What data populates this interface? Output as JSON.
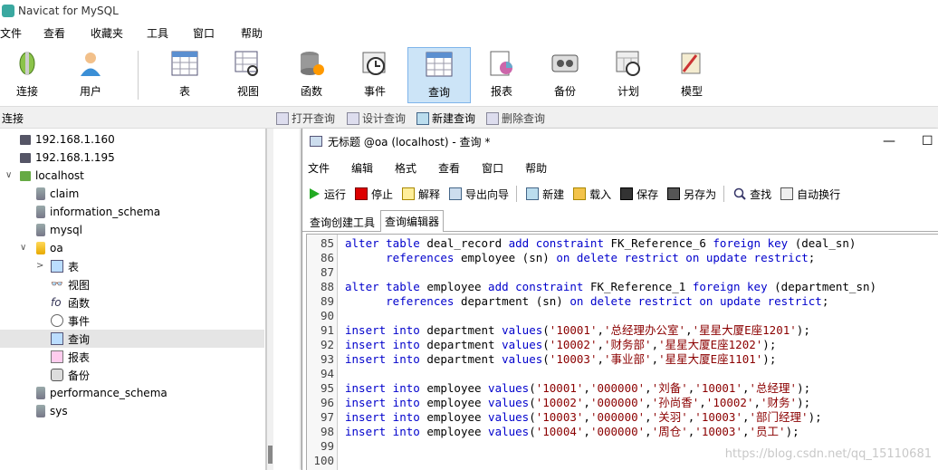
{
  "app": {
    "title": "Navicat for MySQL"
  },
  "menu": [
    "文件",
    "查看",
    "收藏夹",
    "工具",
    "窗口",
    "帮助"
  ],
  "toolbar": [
    {
      "label": "连接",
      "icon": "connection-icon"
    },
    {
      "label": "用户",
      "icon": "user-icon"
    },
    {
      "label": "表",
      "icon": "table-icon"
    },
    {
      "label": "视图",
      "icon": "view-icon"
    },
    {
      "label": "函数",
      "icon": "function-icon"
    },
    {
      "label": "事件",
      "icon": "event-clock-icon"
    },
    {
      "label": "查询",
      "icon": "query-icon",
      "active": true
    },
    {
      "label": "报表",
      "icon": "report-icon"
    },
    {
      "label": "备份",
      "icon": "backup-icon"
    },
    {
      "label": "计划",
      "icon": "schedule-icon"
    },
    {
      "label": "模型",
      "icon": "model-icon"
    }
  ],
  "subbar": {
    "connection_label": "连接",
    "buttons": [
      "打开查询",
      "设计查询",
      "新建查询",
      "删除查询"
    ]
  },
  "tree": [
    {
      "label": "192.168.1.160",
      "type": "server"
    },
    {
      "label": "192.168.1.195",
      "type": "server"
    },
    {
      "label": "localhost",
      "type": "server-open"
    },
    {
      "label": "claim",
      "type": "db"
    },
    {
      "label": "information_schema",
      "type": "db"
    },
    {
      "label": "mysql",
      "type": "db"
    },
    {
      "label": "oa",
      "type": "db-open"
    },
    {
      "label": "表",
      "type": "child"
    },
    {
      "label": "视图",
      "type": "child"
    },
    {
      "label": "函数",
      "type": "child"
    },
    {
      "label": "事件",
      "type": "child"
    },
    {
      "label": "查询",
      "type": "child",
      "selected": true
    },
    {
      "label": "报表",
      "type": "child"
    },
    {
      "label": "备份",
      "type": "child"
    },
    {
      "label": "performance_schema",
      "type": "db"
    },
    {
      "label": "sys",
      "type": "db"
    }
  ],
  "query_window": {
    "title": "无标题 @oa (localhost) - 查询 *",
    "minimize": "—",
    "maximize": "☐",
    "menu": [
      "文件",
      "编辑",
      "格式",
      "查看",
      "窗口",
      "帮助"
    ],
    "tools": [
      "运行",
      "停止",
      "解释",
      "导出向导",
      "新建",
      "载入",
      "保存",
      "另存为",
      "查找",
      "自动换行"
    ],
    "tabs": [
      "查询创建工具",
      "查询编辑器"
    ],
    "lines": [
      {
        "n": "85",
        "segs": [
          [
            "kw",
            "alter table "
          ],
          [
            "id",
            "deal_record "
          ],
          [
            "kw",
            "add constraint "
          ],
          [
            "id",
            "FK_Reference_6 "
          ],
          [
            "kw",
            "foreign key "
          ],
          [
            "id",
            "(deal_sn)"
          ]
        ]
      },
      {
        "n": "86",
        "segs": [
          [
            "id",
            "      "
          ],
          [
            "kw",
            "references "
          ],
          [
            "id",
            "employee (sn) "
          ],
          [
            "kw",
            "on delete restrict on update restrict"
          ],
          [
            "id",
            ";"
          ]
        ]
      },
      {
        "n": "87",
        "segs": []
      },
      {
        "n": "88",
        "segs": [
          [
            "kw",
            "alter table "
          ],
          [
            "id",
            "employee "
          ],
          [
            "kw",
            "add constraint "
          ],
          [
            "id",
            "FK_Reference_1 "
          ],
          [
            "kw",
            "foreign key "
          ],
          [
            "id",
            "(department_sn)"
          ]
        ]
      },
      {
        "n": "89",
        "segs": [
          [
            "id",
            "      "
          ],
          [
            "kw",
            "references "
          ],
          [
            "id",
            "department (sn) "
          ],
          [
            "kw",
            "on delete restrict on update restrict"
          ],
          [
            "id",
            ";"
          ]
        ]
      },
      {
        "n": "90",
        "segs": []
      },
      {
        "n": "91",
        "segs": [
          [
            "kw",
            "insert into "
          ],
          [
            "id",
            "department "
          ],
          [
            "kw",
            "values"
          ],
          [
            "id",
            "("
          ],
          [
            "str",
            "'10001'"
          ],
          [
            "id",
            ","
          ],
          [
            "str",
            "'总经理办公室'"
          ],
          [
            "id",
            ","
          ],
          [
            "str",
            "'星星大厦E座1201'"
          ],
          [
            "id",
            ");"
          ]
        ]
      },
      {
        "n": "92",
        "segs": [
          [
            "kw",
            "insert into "
          ],
          [
            "id",
            "department "
          ],
          [
            "kw",
            "values"
          ],
          [
            "id",
            "("
          ],
          [
            "str",
            "'10002'"
          ],
          [
            "id",
            ","
          ],
          [
            "str",
            "'财务部'"
          ],
          [
            "id",
            ","
          ],
          [
            "str",
            "'星星大厦E座1202'"
          ],
          [
            "id",
            ");"
          ]
        ]
      },
      {
        "n": "93",
        "segs": [
          [
            "kw",
            "insert into "
          ],
          [
            "id",
            "department "
          ],
          [
            "kw",
            "values"
          ],
          [
            "id",
            "("
          ],
          [
            "str",
            "'10003'"
          ],
          [
            "id",
            ","
          ],
          [
            "str",
            "'事业部'"
          ],
          [
            "id",
            ","
          ],
          [
            "str",
            "'星星大厦E座1101'"
          ],
          [
            "id",
            ");"
          ]
        ]
      },
      {
        "n": "94",
        "segs": []
      },
      {
        "n": "95",
        "segs": [
          [
            "kw",
            "insert into "
          ],
          [
            "id",
            "employee "
          ],
          [
            "kw",
            "values"
          ],
          [
            "id",
            "("
          ],
          [
            "str",
            "'10001'"
          ],
          [
            "id",
            ","
          ],
          [
            "str",
            "'000000'"
          ],
          [
            "id",
            ","
          ],
          [
            "str",
            "'刘备'"
          ],
          [
            "id",
            ","
          ],
          [
            "str",
            "'10001'"
          ],
          [
            "id",
            ","
          ],
          [
            "str",
            "'总经理'"
          ],
          [
            "id",
            ");"
          ]
        ]
      },
      {
        "n": "96",
        "segs": [
          [
            "kw",
            "insert into "
          ],
          [
            "id",
            "employee "
          ],
          [
            "kw",
            "values"
          ],
          [
            "id",
            "("
          ],
          [
            "str",
            "'10002'"
          ],
          [
            "id",
            ","
          ],
          [
            "str",
            "'000000'"
          ],
          [
            "id",
            ","
          ],
          [
            "str",
            "'孙尚香'"
          ],
          [
            "id",
            ","
          ],
          [
            "str",
            "'10002'"
          ],
          [
            "id",
            ","
          ],
          [
            "str",
            "'财务'"
          ],
          [
            "id",
            ");"
          ]
        ]
      },
      {
        "n": "97",
        "segs": [
          [
            "kw",
            "insert into "
          ],
          [
            "id",
            "employee "
          ],
          [
            "kw",
            "values"
          ],
          [
            "id",
            "("
          ],
          [
            "str",
            "'10003'"
          ],
          [
            "id",
            ","
          ],
          [
            "str",
            "'000000'"
          ],
          [
            "id",
            ","
          ],
          [
            "str",
            "'关羽'"
          ],
          [
            "id",
            ","
          ],
          [
            "str",
            "'10003'"
          ],
          [
            "id",
            ","
          ],
          [
            "str",
            "'部门经理'"
          ],
          [
            "id",
            ");"
          ]
        ]
      },
      {
        "n": "98",
        "segs": [
          [
            "kw",
            "insert into "
          ],
          [
            "id",
            "employee "
          ],
          [
            "kw",
            "values"
          ],
          [
            "id",
            "("
          ],
          [
            "str",
            "'10004'"
          ],
          [
            "id",
            ","
          ],
          [
            "str",
            "'000000'"
          ],
          [
            "id",
            ","
          ],
          [
            "str",
            "'周仓'"
          ],
          [
            "id",
            ","
          ],
          [
            "str",
            "'10003'"
          ],
          [
            "id",
            ","
          ],
          [
            "str",
            "'员工'"
          ],
          [
            "id",
            ");"
          ]
        ]
      },
      {
        "n": "99",
        "segs": []
      },
      {
        "n": "100",
        "segs": []
      }
    ]
  },
  "watermark": "https://blog.csdn.net/qq_15110681"
}
